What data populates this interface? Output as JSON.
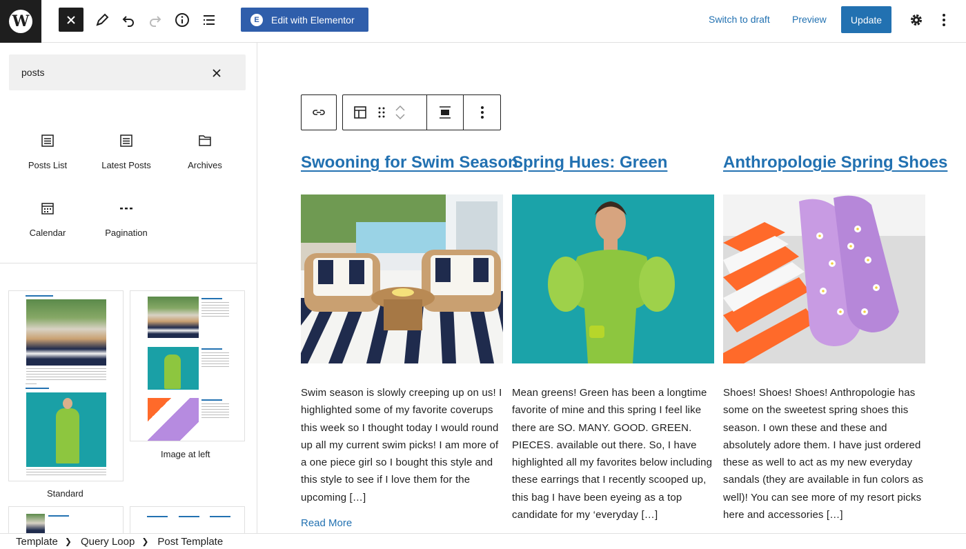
{
  "topbar": {
    "logo_letter": "W",
    "close_icon": "close-icon",
    "edit_with_label": "Edit with Elementor",
    "elementor_badge": "E",
    "switch_to_draft": "Switch to draft",
    "preview": "Preview",
    "update": "Update"
  },
  "inserter": {
    "search_value": "posts",
    "blocks": [
      {
        "label": "Posts List",
        "icon": "posts-list-icon"
      },
      {
        "label": "Latest Posts",
        "icon": "latest-posts-icon"
      },
      {
        "label": "Archives",
        "icon": "archives-icon"
      },
      {
        "label": "Calendar",
        "icon": "calendar-icon"
      },
      {
        "label": "Pagination",
        "icon": "pagination-icon"
      }
    ],
    "patterns": [
      {
        "label": "Standard"
      },
      {
        "label": "Image at left"
      }
    ]
  },
  "posts": [
    {
      "title": "Swooning for Swim Season",
      "excerpt": "Swim season is slowly creeping up on us! I highlighted some of my favorite coverups this week so I thought today I would round up all my current swim picks! I am more of a one piece girl so I bought this style and this style to see if I love them for the upcoming […]"
    },
    {
      "title": "Spring Hues: Green",
      "excerpt": "Mean greens! Green has been a longtime favorite of mine and this spring I feel like there are SO. MANY. GOOD. GREEN. PIECES. available out there. So, I have highlighted all my favorites below including these earrings that I recently scooped up, this bag I have been eyeing as a top candidate for my ‘everyday […]"
    },
    {
      "title": "Anthropologie Spring Shoes",
      "excerpt": "Shoes! Shoes! Shoes! Anthropologie has some on the sweetest spring shoes this season. I own these and these and absolutely adore them. I have just ordered these as well to act as my new everyday sandals (they are available in fun colors as well)! You can see more of my resort picks here and accessories […]"
    }
  ],
  "read_more": "Read More",
  "breadcrumb": [
    "Template",
    "Query Loop",
    "Post Template"
  ],
  "colors": {
    "accent": "#2271b1",
    "elementor": "#2f5eab",
    "dark": "#1e1e1e"
  }
}
